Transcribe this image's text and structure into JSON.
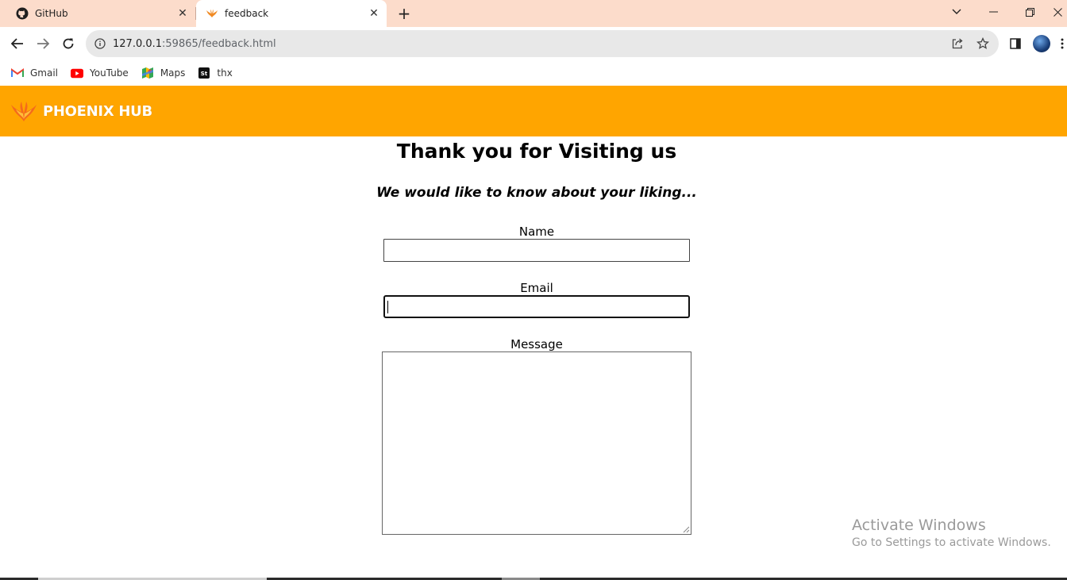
{
  "browser": {
    "tabs": [
      {
        "label": "GitHub",
        "icon": "github-icon",
        "active": false
      },
      {
        "label": "feedback",
        "icon": "phoenix-icon",
        "active": true
      }
    ],
    "url_host": "127.0.0.1",
    "url_path": ":59865/feedback.html",
    "bookmarks": [
      {
        "label": "Gmail",
        "icon": "gmail-icon"
      },
      {
        "label": "YouTube",
        "icon": "youtube-icon"
      },
      {
        "label": "Maps",
        "icon": "maps-icon"
      },
      {
        "label": "thx",
        "icon": "st-icon"
      }
    ]
  },
  "site": {
    "brand": "PHOENIX HUB",
    "accent_color": "#ffa500"
  },
  "page": {
    "heading": "Thank you for Visiting us",
    "subheading": "We would like to know about your liking...",
    "form": {
      "name_label": "Name",
      "name_value": "",
      "email_label": "Email",
      "email_value": "",
      "message_label": "Message",
      "message_value": ""
    }
  },
  "watermark": {
    "title": "Activate Windows",
    "subtitle": "Go to Settings to activate Windows."
  }
}
